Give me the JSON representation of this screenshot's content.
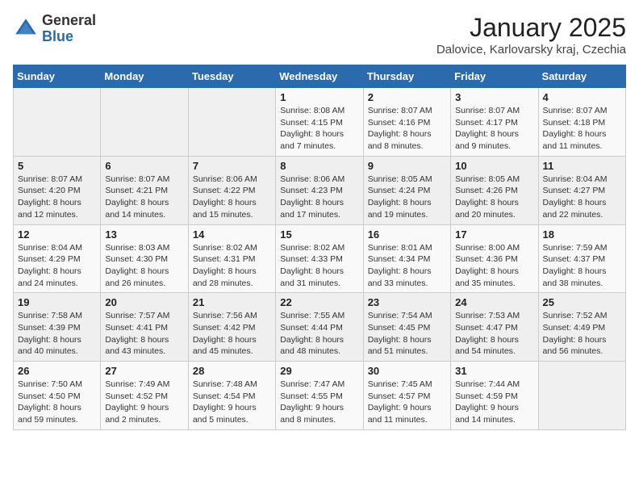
{
  "header": {
    "logo_general": "General",
    "logo_blue": "Blue",
    "month_title": "January 2025",
    "location": "Dalovice, Karlovarsky kraj, Czechia"
  },
  "weekdays": [
    "Sunday",
    "Monday",
    "Tuesday",
    "Wednesday",
    "Thursday",
    "Friday",
    "Saturday"
  ],
  "weeks": [
    [
      {
        "day": "",
        "info": ""
      },
      {
        "day": "",
        "info": ""
      },
      {
        "day": "",
        "info": ""
      },
      {
        "day": "1",
        "info": "Sunrise: 8:08 AM\nSunset: 4:15 PM\nDaylight: 8 hours\nand 7 minutes."
      },
      {
        "day": "2",
        "info": "Sunrise: 8:07 AM\nSunset: 4:16 PM\nDaylight: 8 hours\nand 8 minutes."
      },
      {
        "day": "3",
        "info": "Sunrise: 8:07 AM\nSunset: 4:17 PM\nDaylight: 8 hours\nand 9 minutes."
      },
      {
        "day": "4",
        "info": "Sunrise: 8:07 AM\nSunset: 4:18 PM\nDaylight: 8 hours\nand 11 minutes."
      }
    ],
    [
      {
        "day": "5",
        "info": "Sunrise: 8:07 AM\nSunset: 4:20 PM\nDaylight: 8 hours\nand 12 minutes."
      },
      {
        "day": "6",
        "info": "Sunrise: 8:07 AM\nSunset: 4:21 PM\nDaylight: 8 hours\nand 14 minutes."
      },
      {
        "day": "7",
        "info": "Sunrise: 8:06 AM\nSunset: 4:22 PM\nDaylight: 8 hours\nand 15 minutes."
      },
      {
        "day": "8",
        "info": "Sunrise: 8:06 AM\nSunset: 4:23 PM\nDaylight: 8 hours\nand 17 minutes."
      },
      {
        "day": "9",
        "info": "Sunrise: 8:05 AM\nSunset: 4:24 PM\nDaylight: 8 hours\nand 19 minutes."
      },
      {
        "day": "10",
        "info": "Sunrise: 8:05 AM\nSunset: 4:26 PM\nDaylight: 8 hours\nand 20 minutes."
      },
      {
        "day": "11",
        "info": "Sunrise: 8:04 AM\nSunset: 4:27 PM\nDaylight: 8 hours\nand 22 minutes."
      }
    ],
    [
      {
        "day": "12",
        "info": "Sunrise: 8:04 AM\nSunset: 4:29 PM\nDaylight: 8 hours\nand 24 minutes."
      },
      {
        "day": "13",
        "info": "Sunrise: 8:03 AM\nSunset: 4:30 PM\nDaylight: 8 hours\nand 26 minutes."
      },
      {
        "day": "14",
        "info": "Sunrise: 8:02 AM\nSunset: 4:31 PM\nDaylight: 8 hours\nand 28 minutes."
      },
      {
        "day": "15",
        "info": "Sunrise: 8:02 AM\nSunset: 4:33 PM\nDaylight: 8 hours\nand 31 minutes."
      },
      {
        "day": "16",
        "info": "Sunrise: 8:01 AM\nSunset: 4:34 PM\nDaylight: 8 hours\nand 33 minutes."
      },
      {
        "day": "17",
        "info": "Sunrise: 8:00 AM\nSunset: 4:36 PM\nDaylight: 8 hours\nand 35 minutes."
      },
      {
        "day": "18",
        "info": "Sunrise: 7:59 AM\nSunset: 4:37 PM\nDaylight: 8 hours\nand 38 minutes."
      }
    ],
    [
      {
        "day": "19",
        "info": "Sunrise: 7:58 AM\nSunset: 4:39 PM\nDaylight: 8 hours\nand 40 minutes."
      },
      {
        "day": "20",
        "info": "Sunrise: 7:57 AM\nSunset: 4:41 PM\nDaylight: 8 hours\nand 43 minutes."
      },
      {
        "day": "21",
        "info": "Sunrise: 7:56 AM\nSunset: 4:42 PM\nDaylight: 8 hours\nand 45 minutes."
      },
      {
        "day": "22",
        "info": "Sunrise: 7:55 AM\nSunset: 4:44 PM\nDaylight: 8 hours\nand 48 minutes."
      },
      {
        "day": "23",
        "info": "Sunrise: 7:54 AM\nSunset: 4:45 PM\nDaylight: 8 hours\nand 51 minutes."
      },
      {
        "day": "24",
        "info": "Sunrise: 7:53 AM\nSunset: 4:47 PM\nDaylight: 8 hours\nand 54 minutes."
      },
      {
        "day": "25",
        "info": "Sunrise: 7:52 AM\nSunset: 4:49 PM\nDaylight: 8 hours\nand 56 minutes."
      }
    ],
    [
      {
        "day": "26",
        "info": "Sunrise: 7:50 AM\nSunset: 4:50 PM\nDaylight: 8 hours\nand 59 minutes."
      },
      {
        "day": "27",
        "info": "Sunrise: 7:49 AM\nSunset: 4:52 PM\nDaylight: 9 hours\nand 2 minutes."
      },
      {
        "day": "28",
        "info": "Sunrise: 7:48 AM\nSunset: 4:54 PM\nDaylight: 9 hours\nand 5 minutes."
      },
      {
        "day": "29",
        "info": "Sunrise: 7:47 AM\nSunset: 4:55 PM\nDaylight: 9 hours\nand 8 minutes."
      },
      {
        "day": "30",
        "info": "Sunrise: 7:45 AM\nSunset: 4:57 PM\nDaylight: 9 hours\nand 11 minutes."
      },
      {
        "day": "31",
        "info": "Sunrise: 7:44 AM\nSunset: 4:59 PM\nDaylight: 9 hours\nand 14 minutes."
      },
      {
        "day": "",
        "info": ""
      }
    ]
  ]
}
